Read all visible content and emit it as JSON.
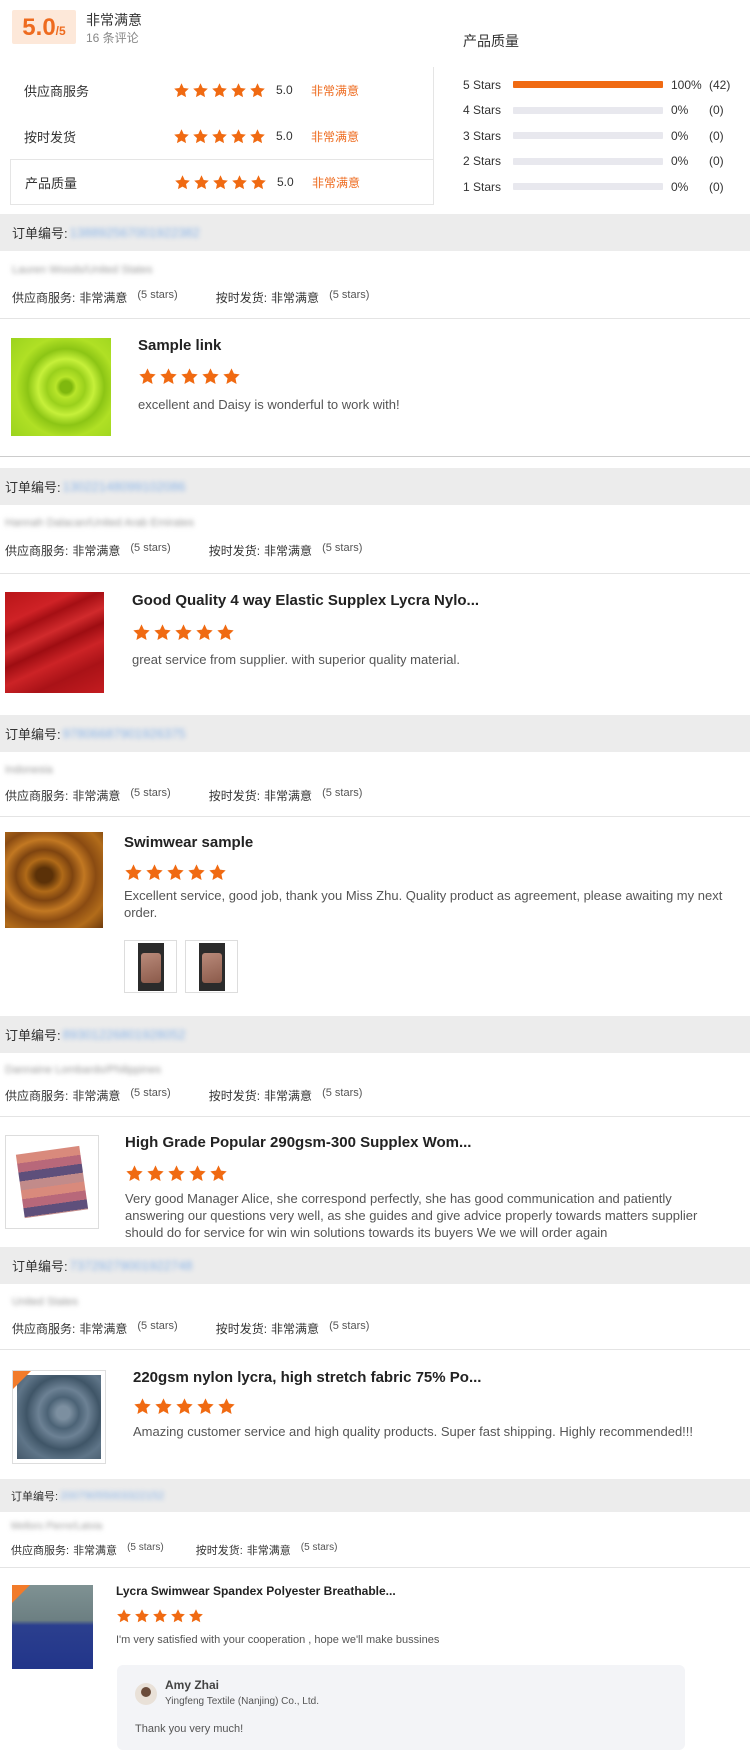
{
  "summary": {
    "score": "5.0",
    "score_max": "/5",
    "overall_label": "非常满意",
    "review_count": "16 条评论",
    "ratings": [
      {
        "label": "供应商服务",
        "value": "5.0",
        "text": "非常满意",
        "stars": 5
      },
      {
        "label": "按时发货",
        "value": "5.0",
        "text": "非常满意",
        "stars": 5
      },
      {
        "label": "产品质量",
        "value": "5.0",
        "text": "非常满意",
        "stars": 5
      }
    ],
    "distribution_title": "产品质量",
    "distribution": [
      {
        "label": "5 Stars",
        "fraction": 1.0,
        "pct": "100%",
        "count": "(42)"
      },
      {
        "label": "4 Stars",
        "fraction": 0.0,
        "pct": "0%",
        "count": "(0)"
      },
      {
        "label": "3 Stars",
        "fraction": 0.0,
        "pct": "0%",
        "count": "(0)"
      },
      {
        "label": "2 Stars",
        "fraction": 0.0,
        "pct": "0%",
        "count": "(0)"
      },
      {
        "label": "1 Stars",
        "fraction": 0.0,
        "pct": "0%",
        "count": "(0)"
      }
    ]
  },
  "labels": {
    "order_no": "订单编号:",
    "supplier_service": "供应商服务:",
    "on_time": "按时发货:",
    "very_satisfied": "非常满意",
    "five_stars": "(5 stars)"
  },
  "colors": {
    "accent": "#ee6b1f",
    "star": "#f06a12",
    "order_bar_bg": "#ececec"
  },
  "reviews": [
    {
      "order_number": "138892567001922382",
      "buyer": "Lauren Woods/United States",
      "product_title": "Sample link",
      "stars": 5,
      "text": "excellent and Daisy is wonderful to work with!"
    },
    {
      "order_number": "13022148099102086",
      "buyer": "Hannah Dalacan/United Arab Emirates",
      "product_title": "Good Quality 4 way Elastic Supplex Lycra Nylo...",
      "stars": 5,
      "text": "great service from supplier. with superior quality material."
    },
    {
      "order_number": "97806687901926375",
      "buyer": "Indonesia",
      "product_title": "Swimwear sample",
      "stars": 5,
      "text": "Excellent service, good job, thank you Miss Zhu. Quality product as agreement, please awaiting my next order.",
      "image_count": 2
    },
    {
      "order_number": "89301226801928052",
      "buyer": "Dannaine Lombardo/Philippines",
      "product_title": "High Grade Popular 290gsm-300 Supplex Wom...",
      "stars": 5,
      "text": "Very good Manager Alice, she correspond perfectly, she has good communication and patiently answering our questions very well,  as she guides and give advice properly towards matters supplier should do for service for win win solutions towards its buyers We we will order again"
    },
    {
      "order_number": "73729279001922748",
      "buyer": "United States",
      "product_title": "220gsm nylon lycra, high stretch fabric 75% Po...",
      "stars": 5,
      "text": "Amazing customer service and high quality products. Super fast shipping. Highly recommended!!!"
    },
    {
      "order_number": "20079055003322152",
      "buyer": "Mellors Pierre/Latvia",
      "product_title": "Lycra Swimwear Spandex Polyester Breathable...",
      "stars": 5,
      "text": "I'm very satisfied with your cooperation , hope we'll make bussines",
      "reply": {
        "name": "Amy Zhai",
        "company": "Yingfeng Textile (Nanjing) Co., Ltd.",
        "message": "Thank you very much!"
      }
    }
  ]
}
